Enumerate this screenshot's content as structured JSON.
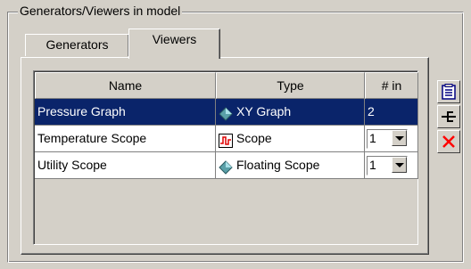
{
  "group": {
    "title": "Generators/Viewers in model"
  },
  "tabs": [
    {
      "label": "Generators",
      "active": false
    },
    {
      "label": "Viewers",
      "active": true
    }
  ],
  "table": {
    "columns": [
      "Name",
      "Type",
      "# in"
    ],
    "rows": [
      {
        "name": "Pressure Graph",
        "type": "XY Graph",
        "type_icon": "diamond-icon",
        "inputs": "2",
        "selected": true,
        "editable": false
      },
      {
        "name": "Temperature Scope",
        "type": "Scope",
        "type_icon": "scope-icon",
        "inputs": "1",
        "selected": false,
        "editable": true
      },
      {
        "name": "Utility Scope",
        "type": "Floating Scope",
        "type_icon": "diamond-icon",
        "inputs": "1",
        "selected": false,
        "editable": true
      }
    ]
  },
  "side_buttons": [
    {
      "name": "properties",
      "icon": "properties-icon"
    },
    {
      "name": "connect",
      "icon": "connect-icon"
    },
    {
      "name": "delete",
      "icon": "delete-icon",
      "color": "#ff0000"
    }
  ],
  "colors": {
    "selection": "#0a246a",
    "background": "#d4d0c8"
  }
}
